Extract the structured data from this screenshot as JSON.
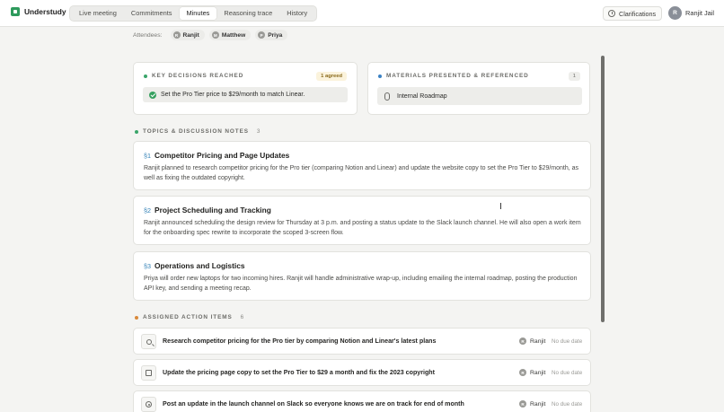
{
  "app": {
    "name": "Understudy",
    "brand_color": "#2e9a5c"
  },
  "tabs": [
    {
      "label": "Live meeting"
    },
    {
      "label": "Commitments"
    },
    {
      "label": "Minutes",
      "active": true
    },
    {
      "label": "Reasoning trace"
    },
    {
      "label": "History"
    }
  ],
  "header": {
    "clarifications_label": "Clarifications",
    "clarifications_icon": "info-icon",
    "user": {
      "initial": "R",
      "name": "Ranjit Jail"
    }
  },
  "attendees": {
    "label": "Attendees:",
    "people": [
      {
        "initial": "R",
        "name": "Ranjit"
      },
      {
        "initial": "M",
        "name": "Matthew"
      },
      {
        "initial": "P",
        "name": "Priya"
      }
    ]
  },
  "decisions": {
    "heading": "KEY DECISIONS REACHED",
    "dot_color": "#3aa56a",
    "badge": "1 agreed",
    "items": [
      {
        "text": "Set the Pro Tier price to $29/month to match Linear."
      }
    ]
  },
  "materials": {
    "heading": "MATERIALS PRESENTED & REFERENCED",
    "dot_color": "#3b82c4",
    "count": "1",
    "items": [
      {
        "text": "Internal Roadmap",
        "icon": "paperclip-icon"
      }
    ]
  },
  "topics": {
    "heading": "TOPICS & DISCUSSION NOTES",
    "dot_color": "#3aa56a",
    "count": "3",
    "items": [
      {
        "num": "§1",
        "title": "Competitor Pricing and Page Updates",
        "body": "Ranjit planned to research competitor pricing for the Pro tier (comparing Notion and Linear) and update the website copy to set the Pro Tier to $29/month, as well as fixing the outdated copyright."
      },
      {
        "num": "§2",
        "title": "Project Scheduling and Tracking",
        "body": "Ranjit announced scheduling the design review for Thursday at 3 p.m. and posting a status update to the Slack launch channel. He will also open a work item for the onboarding spec rewrite to incorporate the scoped 3-screen flow."
      },
      {
        "num": "§3",
        "title": "Operations and Logistics",
        "body": "Priya will order new laptops for two incoming hires. Ranjit will handle administrative wrap-up, including emailing the internal roadmap, posting the production API key, and sending a meeting recap."
      }
    ]
  },
  "actions": {
    "heading": "ASSIGNED ACTION ITEMS",
    "dot_color": "#d9893a",
    "count": "6",
    "items": [
      {
        "icon": "search-icon",
        "text": "Research competitor pricing for the Pro tier by comparing Notion and Linear's latest plans",
        "owner_initial": "R",
        "owner": "Ranjit",
        "due": "No due date"
      },
      {
        "icon": "edit-icon",
        "text": "Update the pricing page copy to set the Pro Tier to $29 a month and fix the 2023 copyright",
        "owner_initial": "R",
        "owner": "Ranjit",
        "due": "No due date"
      },
      {
        "icon": "send-icon",
        "text": "Post an update in the launch channel on Slack so everyone knows we are on track for end of month",
        "owner_initial": "R",
        "owner": "Ranjit",
        "due": "No due date"
      }
    ]
  }
}
